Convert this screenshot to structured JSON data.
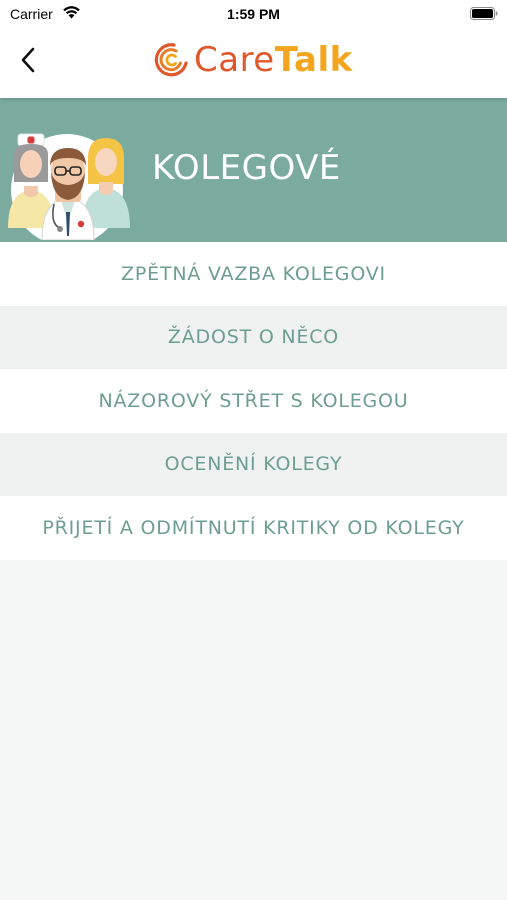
{
  "status_bar": {
    "carrier": "Carrier",
    "time": "1:59 PM"
  },
  "nav": {
    "logo": {
      "care": "Care",
      "talk": "Talk"
    },
    "back_icon": "chevron-left-icon"
  },
  "banner": {
    "title": "KOLEGOVÉ",
    "background": "#7aab9e"
  },
  "menu": {
    "items": [
      {
        "label": "ZPĚTNÁ VAZBA KOLEGOVI"
      },
      {
        "label": "ŽÁDOST O NĚCO"
      },
      {
        "label": "NÁZOROVÝ STŘET S KOLEGOU"
      },
      {
        "label": "OCENĚNÍ KOLEGY"
      },
      {
        "label": "PŘIJETÍ A ODMÍTNUTÍ KRITIKY OD KOLEGY"
      }
    ]
  },
  "colors": {
    "accent_text": "#6e9e91",
    "logo_orange": "#e0582a",
    "logo_yellow": "#f2a51d"
  }
}
